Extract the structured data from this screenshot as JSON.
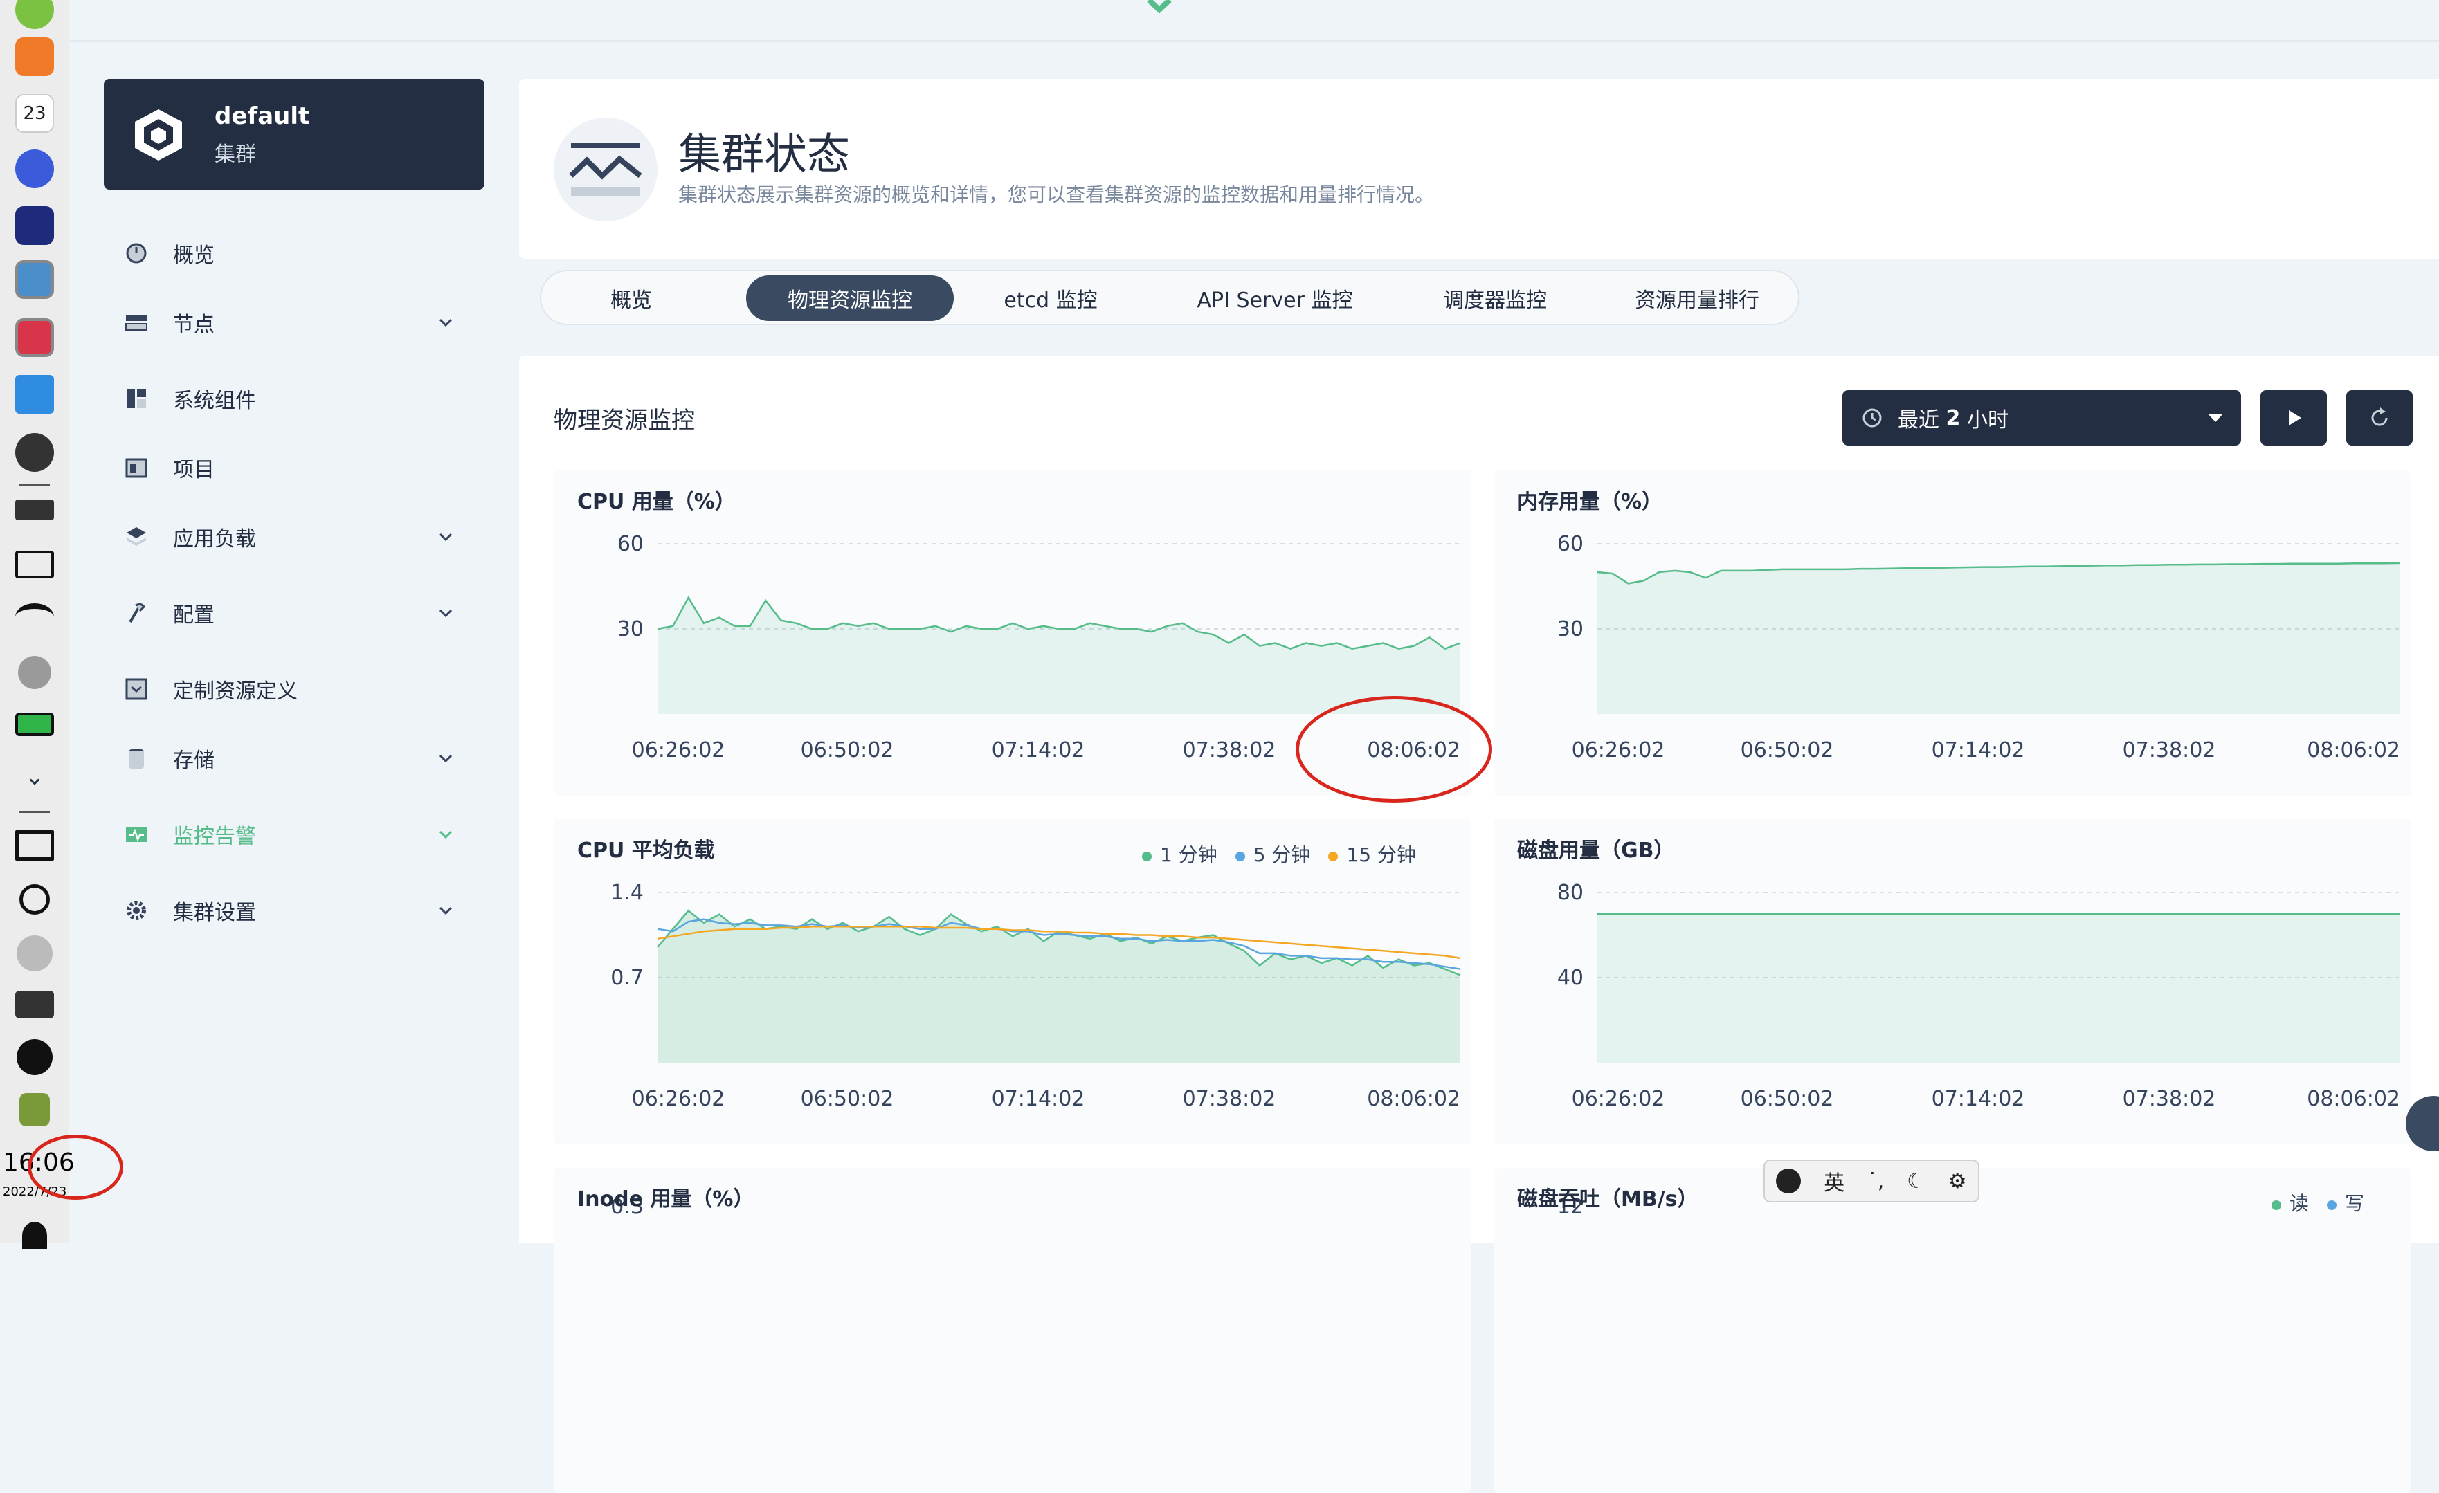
{
  "taskbar": {
    "time": "16:06",
    "date": "2022/7/23",
    "calendar_day": "23"
  },
  "sidebar": {
    "cluster_name": "default",
    "cluster_label": "集群",
    "items": [
      {
        "label": "概览",
        "icon": "dashboard-icon",
        "expandable": false
      },
      {
        "label": "节点",
        "icon": "nodes-icon",
        "expandable": true
      },
      {
        "label": "系统组件",
        "icon": "components-icon",
        "expandable": false
      },
      {
        "label": "项目",
        "icon": "project-icon",
        "expandable": false
      },
      {
        "label": "应用负载",
        "icon": "workload-icon",
        "expandable": true
      },
      {
        "label": "配置",
        "icon": "config-icon",
        "expandable": true
      },
      {
        "label": "定制资源定义",
        "icon": "crd-icon",
        "expandable": false
      },
      {
        "label": "存储",
        "icon": "storage-icon",
        "expandable": true
      },
      {
        "label": "监控告警",
        "icon": "monitor-icon",
        "expandable": true,
        "active": true
      },
      {
        "label": "集群设置",
        "icon": "settings-icon",
        "expandable": true
      }
    ]
  },
  "header": {
    "title": "集群状态",
    "description": "集群状态展示集群资源的概览和详情，您可以查看集群资源的监控数据和用量排行情况。"
  },
  "tabs": [
    {
      "label": "概览",
      "active": false
    },
    {
      "label": "物理资源监控",
      "active": true
    },
    {
      "label": "etcd 监控",
      "active": false
    },
    {
      "label": "API Server 监控",
      "active": false
    },
    {
      "label": "调度器监控",
      "active": false
    },
    {
      "label": "资源用量排行",
      "active": false
    }
  ],
  "main": {
    "section_title": "物理资源监控",
    "time_range_prefix": "最近 ",
    "time_range_value": "2",
    "time_range_suffix": " 小时"
  },
  "ime": {
    "lang": "英"
  },
  "colors": {
    "dark": "#242e42",
    "green": "#55bc8a",
    "blue": "#5aa5e0",
    "orange": "#f5a623",
    "annotation": "#d9261c"
  },
  "chart_data": [
    {
      "type": "area",
      "title": "CPU 用量（%）",
      "x_labels": [
        "06:26:02",
        "06:50:02",
        "07:14:02",
        "07:38:02",
        "08:06:02"
      ],
      "y_ticks": [
        30,
        60
      ],
      "ylim": [
        0,
        60
      ],
      "grid": true,
      "series": [
        {
          "values": [
            30,
            31,
            41,
            32,
            34,
            31,
            31,
            40,
            33,
            32,
            30,
            30,
            32,
            31,
            32,
            30,
            30,
            30,
            31,
            29,
            31,
            30,
            30,
            32,
            30,
            31,
            30,
            30,
            32,
            31,
            30,
            30,
            29,
            31,
            32,
            29,
            28,
            25,
            28,
            24,
            25,
            23,
            25,
            24,
            25,
            23,
            24,
            25,
            23,
            24,
            27,
            23,
            25
          ]
        }
      ]
    },
    {
      "type": "area",
      "title": "内存用量（%）",
      "x_labels": [
        "06:26:02",
        "06:50:02",
        "07:14:02",
        "07:38:02",
        "08:06:02"
      ],
      "y_ticks": [
        30,
        60
      ],
      "ylim": [
        0,
        60
      ],
      "grid": true,
      "series": [
        {
          "values": [
            50,
            49.5,
            46,
            47,
            50,
            50.5,
            50,
            48,
            50.5,
            50.5,
            50.5,
            50.8,
            51,
            51,
            51,
            51,
            51,
            51.2,
            51.2,
            51.3,
            51.4,
            51.5,
            51.5,
            51.6,
            51.7,
            51.8,
            51.8,
            51.9,
            52,
            52,
            52.1,
            52.2,
            52.3,
            52.4,
            52.4,
            52.5,
            52.5,
            52.6,
            52.6,
            52.7,
            52.7,
            52.8,
            52.8,
            52.9,
            52.9,
            53,
            53,
            53,
            53,
            53.1,
            53.1,
            53.1,
            53.2
          ]
        }
      ]
    },
    {
      "type": "area",
      "title": "CPU 平均负载",
      "x_labels": [
        "06:26:02",
        "06:50:02",
        "07:14:02",
        "07:38:02",
        "08:06:02"
      ],
      "y_ticks": [
        0.7,
        1.4
      ],
      "ylim": [
        0,
        1.4
      ],
      "grid": true,
      "legend_position": "top-right",
      "series": [
        {
          "name": "1 分钟",
          "color": "#55bc8a",
          "values": [
            0.95,
            1.1,
            1.25,
            1.15,
            1.22,
            1.12,
            1.18,
            1.1,
            1.12,
            1.1,
            1.18,
            1.1,
            1.15,
            1.08,
            1.12,
            1.2,
            1.1,
            1.05,
            1.1,
            1.22,
            1.14,
            1.08,
            1.12,
            1.04,
            1.1,
            1.0,
            1.08,
            1.05,
            1.02,
            1.06,
            1.0,
            1.03,
            0.98,
            1.04,
            1.0,
            1.03,
            1.05,
            0.98,
            0.92,
            0.8,
            0.9,
            0.85,
            0.88,
            0.82,
            0.86,
            0.8,
            0.88,
            0.78,
            0.85,
            0.8,
            0.82,
            0.77,
            0.72
          ]
        },
        {
          "name": "5 分钟",
          "color": "#5aa5e0",
          "values": [
            1.1,
            1.08,
            1.16,
            1.18,
            1.15,
            1.14,
            1.15,
            1.13,
            1.13,
            1.12,
            1.14,
            1.12,
            1.13,
            1.11,
            1.12,
            1.14,
            1.12,
            1.1,
            1.1,
            1.15,
            1.13,
            1.1,
            1.1,
            1.08,
            1.08,
            1.05,
            1.06,
            1.05,
            1.04,
            1.04,
            1.02,
            1.02,
            1.0,
            1.01,
            1.0,
            1.0,
            1.01,
            0.99,
            0.96,
            0.9,
            0.9,
            0.88,
            0.88,
            0.86,
            0.86,
            0.85,
            0.85,
            0.83,
            0.83,
            0.82,
            0.81,
            0.79,
            0.77
          ]
        },
        {
          "name": "15 分钟",
          "color": "#f5a623",
          "values": [
            1.02,
            1.04,
            1.06,
            1.08,
            1.09,
            1.1,
            1.1,
            1.1,
            1.11,
            1.11,
            1.12,
            1.12,
            1.12,
            1.12,
            1.12,
            1.12,
            1.12,
            1.12,
            1.11,
            1.11,
            1.11,
            1.1,
            1.1,
            1.09,
            1.09,
            1.08,
            1.08,
            1.07,
            1.07,
            1.06,
            1.06,
            1.05,
            1.05,
            1.04,
            1.04,
            1.03,
            1.03,
            1.02,
            1.01,
            1.0,
            0.99,
            0.98,
            0.97,
            0.96,
            0.95,
            0.94,
            0.93,
            0.92,
            0.91,
            0.9,
            0.89,
            0.88,
            0.86
          ]
        }
      ]
    },
    {
      "type": "area",
      "title": "磁盘用量（GB）",
      "x_labels": [
        "06:26:02",
        "06:50:02",
        "07:14:02",
        "07:38:02",
        "08:06:02"
      ],
      "y_ticks": [
        40,
        80
      ],
      "ylim": [
        0,
        80
      ],
      "grid": true,
      "series": [
        {
          "values": [
            70,
            70,
            70,
            70,
            70,
            70,
            70,
            70,
            70,
            70
          ]
        }
      ]
    },
    {
      "type": "area",
      "title": "Inode 用量（%）",
      "y_ticks": [
        0.3
      ],
      "series": []
    },
    {
      "type": "area",
      "title": "磁盘吞吐（MB/s）",
      "y_ticks": [
        12
      ],
      "legend_position": "top-right",
      "series": [
        {
          "name": "读",
          "color": "#55bc8a",
          "values": []
        },
        {
          "name": "写",
          "color": "#5aa5e0",
          "values": []
        }
      ]
    }
  ]
}
